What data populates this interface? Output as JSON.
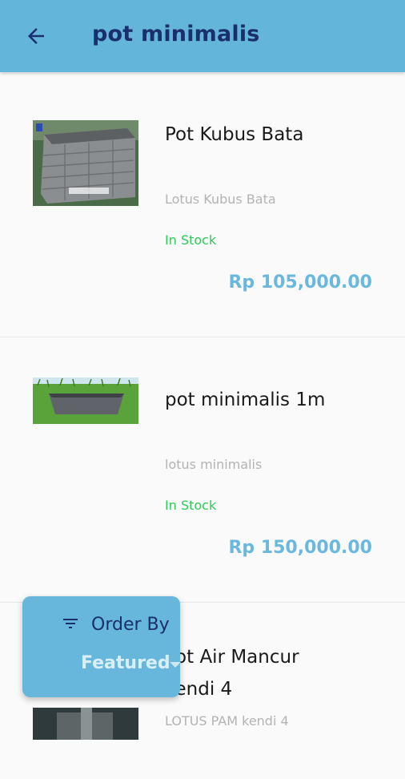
{
  "header": {
    "title": "pot minimalis",
    "back_icon": "arrow-left-icon"
  },
  "products": [
    {
      "name": "Pot Kubus Bata",
      "brand": "Lotus Kubus Bata",
      "stock": "In Stock",
      "price": "Rp 105,000.00"
    },
    {
      "name": "pot minimalis 1m",
      "brand": "lotus minimalis",
      "stock": "In Stock",
      "price": "Rp 150,000.00"
    },
    {
      "name_line1": "Pot Air Mancur",
      "name_line2": "kendi 4",
      "brand": "LOTUS PAM kendi 4"
    }
  ],
  "sort": {
    "label": "Order By",
    "value": "Featured",
    "icon": "filter-list-icon"
  },
  "colors": {
    "appbar": "#64b5da",
    "accent": "#6ab8de",
    "in_stock": "#2ecc55",
    "title": "#1a2f6e"
  }
}
